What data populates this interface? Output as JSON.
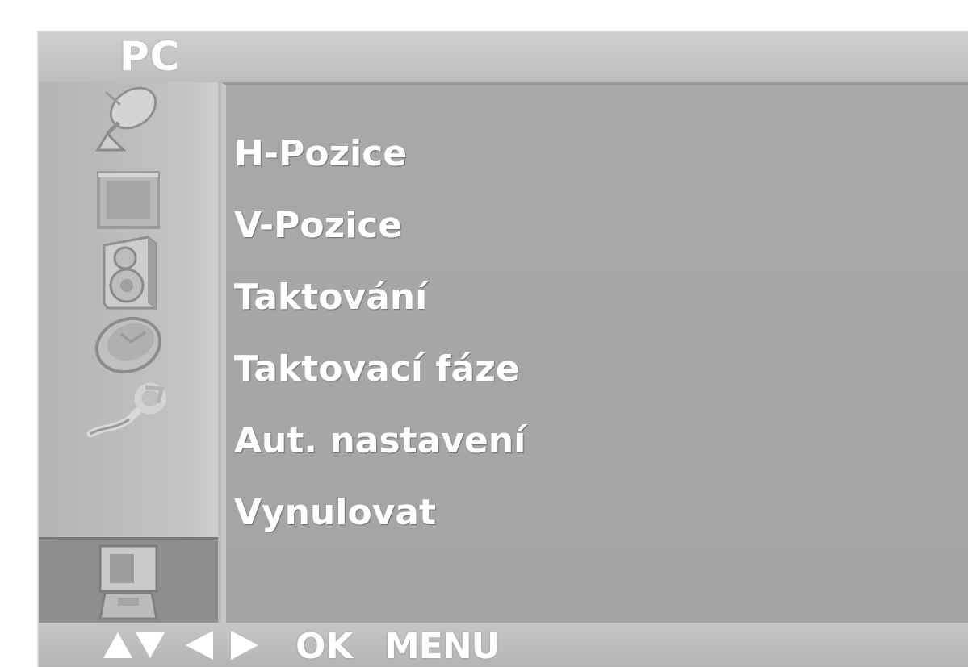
{
  "osd": {
    "title": "PC",
    "menu_items": [
      "H-Pozice",
      "V-Pozice",
      "Taktování",
      "Taktovací fáze",
      "Aut. nastavení",
      "Vynulovat"
    ],
    "sidebar_icons": [
      "satellite-dish-icon",
      "picture-icon",
      "speaker-icon",
      "clock-icon",
      "wrench-icon",
      "pc-monitor-icon"
    ],
    "active_sidebar_index": 5,
    "footer": {
      "up_down_icon": "up-down-arrows-icon",
      "left_right_icon": "left-right-arrows-icon",
      "ok_label": "OK",
      "menu_label": "MENU"
    },
    "colors": {
      "panel_bg": "#b9b9b9",
      "content_bg": "#a6a6a6",
      "active_item_bg": "#8e8e8e",
      "text": "#ffffff"
    }
  }
}
